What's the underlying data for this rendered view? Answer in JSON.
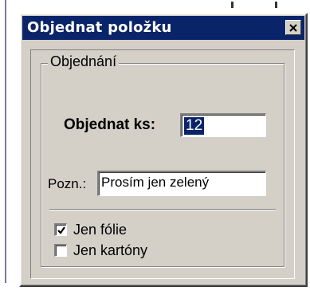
{
  "window": {
    "title": "Objednat položku",
    "close_icon": "close-icon"
  },
  "group": {
    "legend": "Objednání",
    "quantity": {
      "label": "Objednat ks:",
      "value": "12"
    },
    "note": {
      "label": "Pozn.:",
      "value": "Prosím jen zelený"
    },
    "options": [
      {
        "label": "Jen fólie",
        "checked": true
      },
      {
        "label": "Jen kartóny",
        "checked": false
      }
    ]
  },
  "colors": {
    "titlebar": "#0a246a",
    "face": "#d4d0c8",
    "selection": "#0a246a"
  }
}
